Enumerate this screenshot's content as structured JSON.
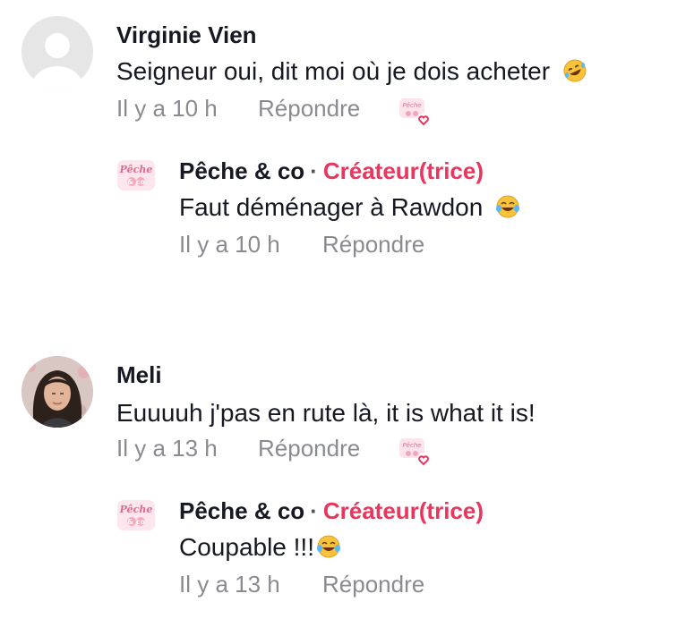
{
  "comments": [
    {
      "author": "Virginie Vien",
      "text": "Seigneur oui, dit moi où je dois acheter",
      "emoji": "rofl",
      "time": "Il y a 10 h",
      "reply_label": "Répondre",
      "reply": {
        "author": "Pêche & co",
        "separator": "·",
        "badge": "Créateur(trice)",
        "text": "Faut déménager à Rawdon",
        "emoji": "joy",
        "time": "Il y a 10 h",
        "reply_label": "Répondre"
      }
    },
    {
      "author": "Meli",
      "text": "Euuuuh j'pas en rute là, it is what it is!",
      "time": "Il y a 13 h",
      "reply_label": "Répondre",
      "reply": {
        "author": "Pêche & co",
        "separator": "·",
        "badge": "Créateur(trice)",
        "text": "Coupable !!!",
        "emoji": "joy",
        "time": "Il y a 13 h",
        "reply_label": "Répondre"
      }
    }
  ],
  "colors": {
    "creator_badge": "#e8365d",
    "meta_text": "#8a8b91",
    "heart": "#e8365d"
  },
  "icons": [
    "default-avatar-icon",
    "creator-logo-icon",
    "creator-liked-heart-icon",
    "rofl-emoji-icon",
    "joy-emoji-icon"
  ]
}
